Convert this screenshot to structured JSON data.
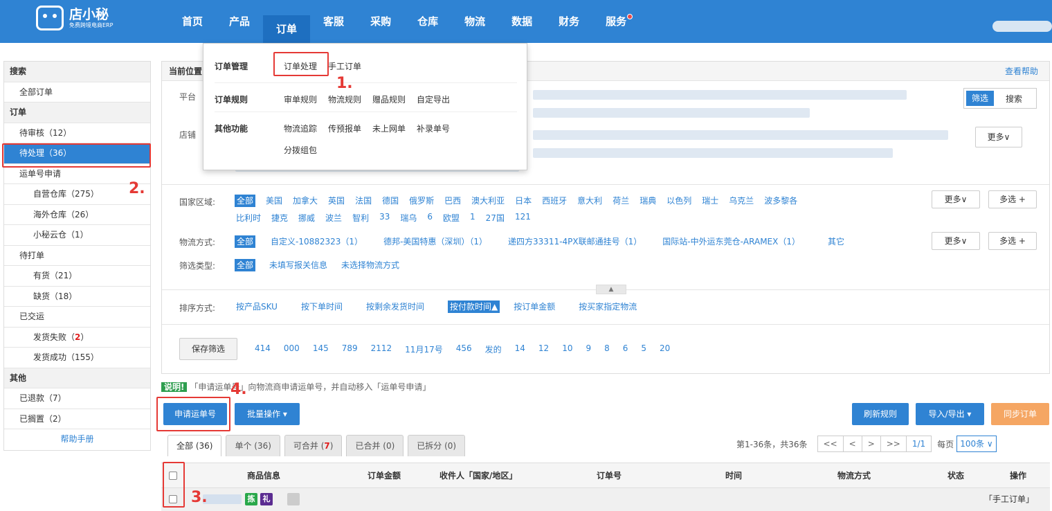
{
  "logo": {
    "title": "店小秘",
    "subtitle": "免费跨境电商ERP"
  },
  "nav": {
    "items": [
      "首页",
      "产品",
      "订单",
      "客服",
      "采购",
      "仓库",
      "物流",
      "数据",
      "财务",
      "服务"
    ],
    "active_index": 2
  },
  "dropdown": {
    "row1_label": "订单管理",
    "row1_items": [
      "订单处理",
      "手工订单"
    ],
    "row2_label": "订单规则",
    "row2_items": [
      "审单规则",
      "物流规则",
      "赠品规则",
      "自定导出"
    ],
    "row3_label": "其他功能",
    "row3_items": [
      "物流追踪",
      "传预报单",
      "未上网单",
      "补录单号"
    ],
    "row3_extra": "分拨组包"
  },
  "sidebar": {
    "search_head": "搜索",
    "all_orders": "全部订单",
    "order_head": "订单",
    "pending_review": "待审核",
    "pending_review_count": "（12）",
    "pending_process": "待处理（36）",
    "waybill_apply": "运单号申请",
    "self_warehouse": "自营仓库（275）",
    "overseas_warehouse": "海外仓库（26）",
    "cloud_warehouse": "小秘云仓（1）",
    "to_print": "待打单",
    "in_stock": "有货（21）",
    "out_stock": "缺货（18）",
    "shipped": "已交运",
    "ship_failed": "发货失败（",
    "ship_failed_count": "2",
    "ship_failed_end": "）",
    "ship_success": "发货成功（155）",
    "other_head": "其他",
    "refunded": "已退款（7）",
    "shelved": "已搁置（2）",
    "help": "帮助手册"
  },
  "main": {
    "crumb": "当前位置",
    "help_link": "查看帮助",
    "platform_label": "平台",
    "shop_label": "店铺",
    "filter_btn": "筛选",
    "search_btn": "搜索",
    "more_btn": "更多∨",
    "country_label": "国家区域:",
    "countries_row1": [
      "全部",
      "美国",
      "加拿大",
      "英国",
      "法国",
      "德国",
      "俄罗斯",
      "巴西",
      "澳大利亚",
      "日本",
      "西班牙",
      "意大利",
      "荷兰",
      "瑞典",
      "以色列",
      "瑞士",
      "乌克兰",
      "波多黎各"
    ],
    "countries_row2": [
      "比利时",
      "捷克",
      "挪威",
      "波兰",
      "智利",
      "33",
      "瑞乌",
      "6",
      "欧盟",
      "1",
      "27国",
      "121"
    ],
    "more": "更多∨",
    "multi": "多选 +",
    "logistics_label": "物流方式:",
    "logistics": [
      "全部",
      "自定义-10882323（1）",
      "德邦-美国特惠（深圳）（1）",
      "递四方33311-4PX联邮通挂号（1）",
      "国际站-中外运东莞仓-ARAMEX（1）",
      "其它"
    ],
    "filter_type_label": "筛选类型:",
    "filter_types": [
      "全部",
      "未填写报关信息",
      "未选择物流方式"
    ],
    "sort_label": "排序方式:",
    "sorts": [
      "按产品SKU",
      "按下单时间",
      "按剩余发货时间",
      "按付款时间▲",
      "按订单金额",
      "按买家指定物流"
    ],
    "save_filter": "保存筛选",
    "saved": [
      "414",
      "000",
      "145",
      "789",
      "2112",
      "11月17号",
      "456",
      "发的",
      "14",
      "12",
      "10",
      "9",
      "8",
      "6",
      "5",
      "20"
    ]
  },
  "note": {
    "badge": "说明!",
    "text": "「申请运单号」向物流商申请运单号，并自动移入「运单号申请」"
  },
  "actions": {
    "apply": "申请运单号",
    "batch": "批量操作 ▾",
    "refresh": "刷新规则",
    "import_export": "导入/导出 ▾",
    "sync": "同步订单"
  },
  "tabs": {
    "all": "全部 (36)",
    "single": "单个 (36)",
    "mergeable": "可合并 (",
    "mergeable_count": "7",
    "mergeable_end": ")",
    "merged": "已合并 (0)",
    "split": "已拆分 (0)"
  },
  "pager": {
    "info": "第1-36条，共36条",
    "first": "<<",
    "prev": "<",
    "next": ">",
    "last": ">>",
    "page": "1/1",
    "per_label": "每页",
    "per": "100条 ∨"
  },
  "table": {
    "headers": [
      "商品信息",
      "订单金额",
      "收件人「国家/地区」",
      "订单号",
      "时间",
      "物流方式",
      "状态",
      "操作"
    ],
    "row_tag1": "拣",
    "row_tag2": "礼",
    "row_action": "「手工订单」"
  },
  "annotations": [
    "1.",
    "2.",
    "3.",
    "4."
  ],
  "colors": {
    "primary": "#2f83d3",
    "highlight": "#e53935",
    "sync": "#f5a663"
  }
}
